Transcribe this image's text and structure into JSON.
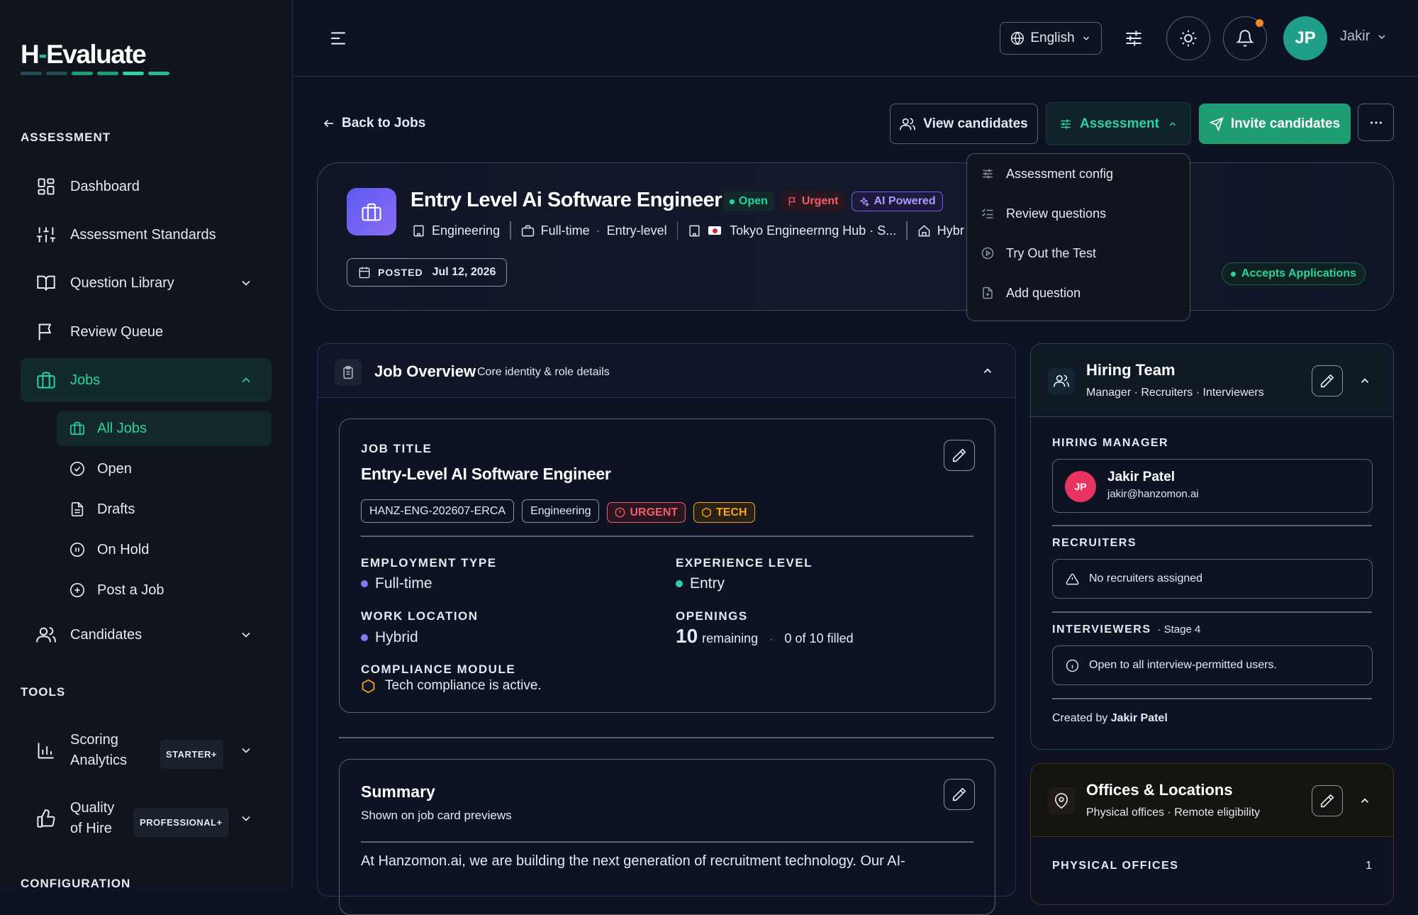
{
  "app": {
    "logo_left": "H",
    "logo_dash": "-",
    "logo_right": "Evaluate"
  },
  "colors": {
    "accent": "#2bd49f",
    "brand_green": "#1f9e74",
    "urgent": "#f25c6a",
    "tech": "#f5a524",
    "ai": "#8b7cf6",
    "avatar_pink": "#e8345f"
  },
  "sidebar": {
    "assessment_label": "ASSESSMENT",
    "items": [
      {
        "label": "Dashboard",
        "icon": "dashboard-icon"
      },
      {
        "label": "Assessment Standards",
        "icon": "sliders-icon"
      },
      {
        "label": "Question Library",
        "icon": "book-icon"
      },
      {
        "label": "Review Queue",
        "icon": "flag-icon"
      },
      {
        "label": "Jobs",
        "icon": "briefcase-icon"
      }
    ],
    "jobs_sub": [
      {
        "label": "All Jobs",
        "icon": "briefcase-icon"
      },
      {
        "label": "Open",
        "icon": "check-circle-icon"
      },
      {
        "label": "Drafts",
        "icon": "document-icon"
      },
      {
        "label": "On Hold",
        "icon": "pause-circle-icon"
      },
      {
        "label": "Post a Job",
        "icon": "plus-circle-icon"
      }
    ],
    "candidates": "Candidates",
    "tools_label": "TOOLS",
    "scoring": {
      "line1": "Scoring",
      "line2": "Analytics",
      "badge": "STARTER+"
    },
    "quality": {
      "line1": "Quality",
      "line2": "of Hire",
      "badge": "PROFESSIONAL+"
    },
    "config_label": "CONFIGURATION"
  },
  "topbar": {
    "language": "English",
    "avatar_initials": "JP",
    "user_name": "Jakir"
  },
  "actions": {
    "back": "Back to Jobs",
    "view_candidates": "View candidates",
    "assessment": "Assessment",
    "invite": "Invite candidates"
  },
  "assessment_menu": [
    {
      "label": "Assessment config",
      "icon": "sliders-icon"
    },
    {
      "label": "Review questions",
      "icon": "checklist-icon"
    },
    {
      "label": "Try Out the Test",
      "icon": "play-circle-icon"
    },
    {
      "label": "Add question",
      "icon": "file-plus-icon"
    }
  ],
  "job_header": {
    "title": "Entry Level Ai Software Engineer",
    "status_open": "Open",
    "status_urgent": "Urgent",
    "status_ai": "AI Powered",
    "department": "Engineering",
    "employment": "Full-time",
    "level": "Entry-level",
    "location": "Tokyo Engineernng Hub · S...",
    "work_mode": "Hybr",
    "posted_label": "POSTED",
    "posted_date": "Jul 12, 2026",
    "accepts": "Accepts Applications"
  },
  "overview": {
    "title": "Job Overview",
    "subtitle": "Core identity & role details",
    "job_title_label": "JOB TITLE",
    "job_title": "Entry-Level AI Software Engineer",
    "code": "HANZ-ENG-202607-ERCA",
    "dept_tag": "Engineering",
    "urgent_tag": "URGENT",
    "tech_tag": "TECH",
    "employment_label": "EMPLOYMENT TYPE",
    "employment_value": "Full-time",
    "experience_label": "EXPERIENCE LEVEL",
    "experience_value": "Entry",
    "location_label": "WORK LOCATION",
    "location_value": "Hybrid",
    "openings_label": "OPENINGS",
    "openings_number": "10",
    "openings_remaining": "remaining",
    "openings_filled": "0 of 10 filled",
    "compliance_label": "COMPLIANCE MODULE",
    "compliance_value": "Tech compliance is active."
  },
  "summary": {
    "title": "Summary",
    "subtitle": "Shown on job card previews",
    "text": "At Hanzomon.ai, we are building the next generation of recruitment technology. Our AI-"
  },
  "hiring_team": {
    "title": "Hiring Team",
    "subtitle": "Manager · Recruiters · Interviewers",
    "manager_label": "HIRING MANAGER",
    "manager_initials": "JP",
    "manager_name": "Jakir Patel",
    "manager_email": "jakir@hanzomon.ai",
    "recruiters_label": "RECRUITERS",
    "recruiters_value": "No recruiters assigned",
    "interviewers_label": "INTERVIEWERS",
    "interviewers_stage": "· Stage 4",
    "interviewers_value": "Open to all interview-permitted users.",
    "created_prefix": "Created by",
    "created_by": "Jakir Patel"
  },
  "offices": {
    "title": "Offices & Locations",
    "subtitle": "Physical offices · Remote eligibility",
    "physical_label": "PHYSICAL OFFICES",
    "physical_count": "1"
  }
}
